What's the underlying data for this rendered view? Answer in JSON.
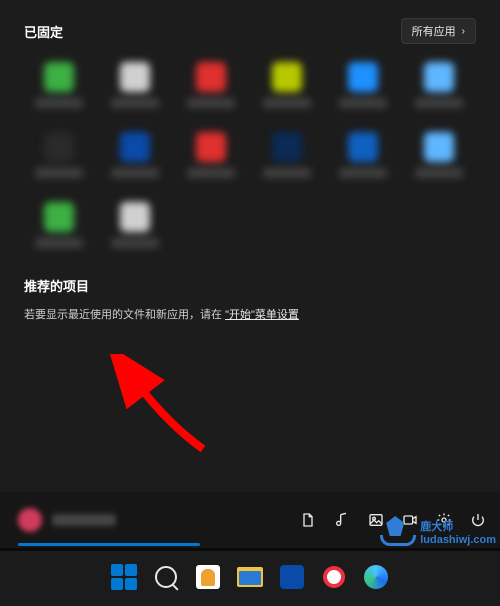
{
  "pinned": {
    "title": "已固定",
    "all_apps_label": "所有应用",
    "apps": [
      {
        "color": "ic-g"
      },
      {
        "color": "ic-w"
      },
      {
        "color": "ic-r"
      },
      {
        "color": "ic-y"
      },
      {
        "color": "ic-b"
      },
      {
        "color": "ic-lb"
      },
      {
        "color": "ic-dk"
      },
      {
        "color": "ic-tb"
      },
      {
        "color": "ic-r"
      },
      {
        "color": "ic-db"
      },
      {
        "color": "ic-vb"
      },
      {
        "color": "ic-lb"
      },
      {
        "color": "ic-g"
      },
      {
        "color": "ic-w"
      }
    ]
  },
  "recommended": {
    "title": "推荐的项目",
    "hint_prefix": "若要显示最近使用的文件和新应用，请在 ",
    "hint_link": "\"开始\"菜单设置"
  },
  "util": {
    "doc": "document-icon",
    "music": "music-icon",
    "photo": "photo-icon",
    "video": "video-icon",
    "settings": "settings-icon",
    "power": "power-icon"
  },
  "watermark": {
    "text_top": "鹿大师",
    "text_bottom": "ludashiwj.com"
  }
}
